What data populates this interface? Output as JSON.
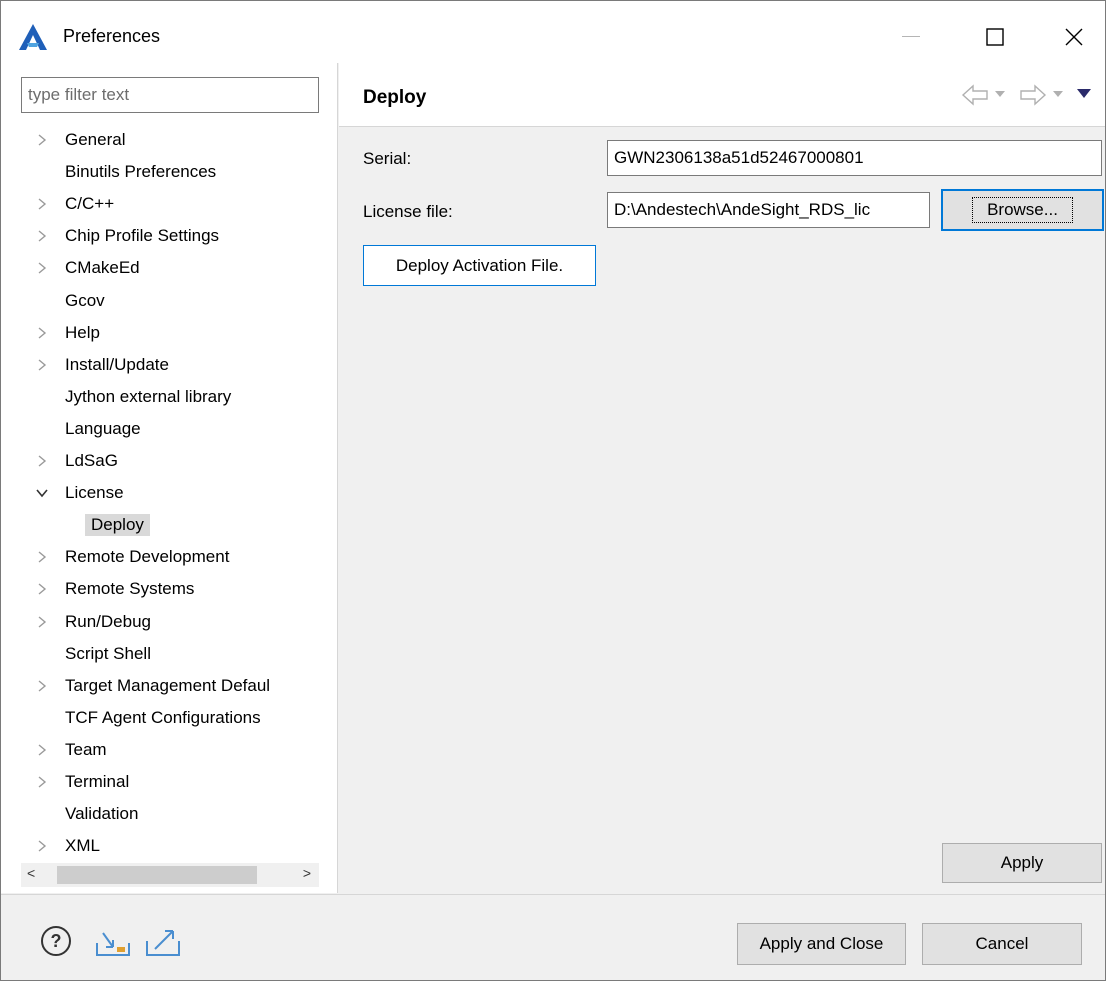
{
  "window": {
    "title": "Preferences",
    "app_icon": "andesight-logo-icon"
  },
  "filter": {
    "placeholder": "type filter text",
    "value": ""
  },
  "tree": {
    "items": [
      {
        "label": "General",
        "expandable": true
      },
      {
        "label": "Binutils Preferences",
        "expandable": false
      },
      {
        "label": "C/C++",
        "expandable": true
      },
      {
        "label": "Chip Profile Settings",
        "expandable": true
      },
      {
        "label": "CMakeEd",
        "expandable": true
      },
      {
        "label": "Gcov",
        "expandable": false
      },
      {
        "label": "Help",
        "expandable": true
      },
      {
        "label": "Install/Update",
        "expandable": true
      },
      {
        "label": "Jython external library",
        "expandable": false
      },
      {
        "label": "Language",
        "expandable": false
      },
      {
        "label": "LdSaG",
        "expandable": true
      },
      {
        "label": "License",
        "expandable": true,
        "expanded": true
      },
      {
        "label": "Deploy",
        "expandable": false,
        "child": true,
        "selected": true
      },
      {
        "label": "Remote Development",
        "expandable": true
      },
      {
        "label": "Remote Systems",
        "expandable": true
      },
      {
        "label": "Run/Debug",
        "expandable": true
      },
      {
        "label": "Script Shell",
        "expandable": false
      },
      {
        "label": "Target Management Defaul",
        "expandable": true
      },
      {
        "label": "TCF Agent Configurations",
        "expandable": false
      },
      {
        "label": "Team",
        "expandable": true
      },
      {
        "label": "Terminal",
        "expandable": true
      },
      {
        "label": "Validation",
        "expandable": false
      },
      {
        "label": "XML",
        "expandable": true
      }
    ]
  },
  "page": {
    "title": "Deploy",
    "serial_label": "Serial:",
    "serial_value": "GWN2306138a51d52467000801",
    "license_label": "License file:",
    "license_value": "D:\\Andestech\\AndeSight_RDS_lic",
    "browse_label": "Browse...",
    "deploy_button": "Deploy Activation File.",
    "apply_label": "Apply"
  },
  "footer": {
    "apply_close": "Apply and Close",
    "cancel": "Cancel",
    "icons": [
      "help-icon",
      "import-icon",
      "export-icon"
    ]
  },
  "colors": {
    "focus_blue": "#0078d7",
    "selection_gray": "#d9d9d9",
    "logo_blue": "#1f5fb8"
  }
}
